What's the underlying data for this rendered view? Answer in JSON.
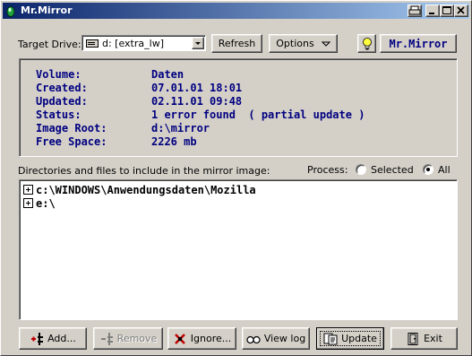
{
  "window": {
    "title": "Mr.Mirror"
  },
  "top": {
    "target_drive_label": "Target Drive:",
    "drive_value": "d: [extra_lw]",
    "refresh_label": "Refresh",
    "options_label": "Options",
    "brand_label": "Mr.Mirror"
  },
  "info": {
    "rows": [
      {
        "key": "Volume:",
        "value": "Daten"
      },
      {
        "key": "Created:",
        "value": "07.01.01 18:01"
      },
      {
        "key": "Updated:",
        "value": "02.11.01 09:48"
      },
      {
        "key": "Status:",
        "value": "1 error found  ( partial update )"
      },
      {
        "key": "Image Root:",
        "value": "d:\\mirror"
      },
      {
        "key": "Free Space:",
        "value": "2226 mb"
      }
    ]
  },
  "list": {
    "heading": "Directories and files to include in the mirror image:",
    "process_label": "Process:",
    "selected_label": "Selected",
    "all_label": "All",
    "process_mode": "All",
    "items": [
      "c:\\WINDOWS\\Anwendungsdaten\\Mozilla",
      "e:\\"
    ]
  },
  "buttons": {
    "add": "Add...",
    "remove": "Remove",
    "ignore": "Ignore...",
    "viewlog": "View log",
    "update": "Update",
    "exit": "Exit"
  },
  "icons": {
    "app": "mirror-drop-icon",
    "drive": "drive-icon",
    "bulb": "lightbulb-icon",
    "add": "add-icon",
    "remove": "remove-icon",
    "ignore": "ignore-icon",
    "viewlog": "glasses-icon",
    "update": "update-icon",
    "exit": "exit-door-icon"
  }
}
